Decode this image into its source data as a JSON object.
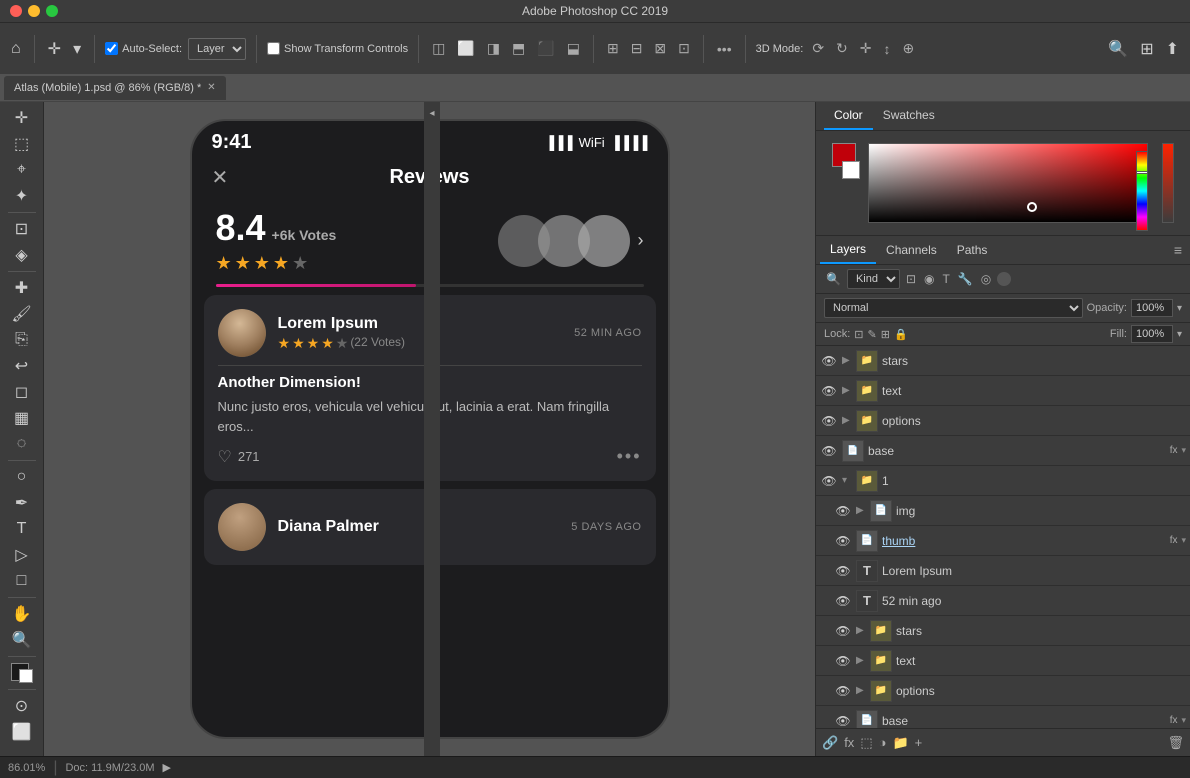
{
  "app": {
    "title": "Adobe Photoshop CC 2019",
    "tab": "Atlas (Mobile) 1.psd @ 86% (RGB/8) *"
  },
  "toolbar": {
    "auto_select_label": "Auto-Select:",
    "auto_select_value": "Layer",
    "transform_controls_label": "Show Transform Controls",
    "three_d_mode_label": "3D Mode:",
    "more_label": "..."
  },
  "color_panel": {
    "tab1": "Color",
    "tab2": "Swatches"
  },
  "layers_panel": {
    "tab1": "Layers",
    "tab2": "Channels",
    "tab3": "Paths",
    "filter_kind": "Kind",
    "blend_mode": "Normal",
    "opacity_label": "Opacity:",
    "opacity_value": "100%",
    "lock_label": "Lock:",
    "fill_label": "Fill:",
    "fill_value": "100%",
    "layers": [
      {
        "id": "stars1",
        "name": "stars",
        "type": "group",
        "visible": true,
        "indent": 0,
        "fx": false
      },
      {
        "id": "text1",
        "name": "text",
        "type": "group",
        "visible": true,
        "indent": 0,
        "fx": false
      },
      {
        "id": "options1",
        "name": "options",
        "type": "group",
        "visible": true,
        "indent": 0,
        "fx": false
      },
      {
        "id": "base1",
        "name": "base",
        "type": "smart",
        "visible": true,
        "indent": 0,
        "fx": true
      },
      {
        "id": "group1",
        "name": "1",
        "type": "group",
        "visible": true,
        "indent": 0,
        "fx": false,
        "expanded": true
      },
      {
        "id": "img1",
        "name": "img",
        "type": "smart",
        "visible": true,
        "indent": 1,
        "fx": false
      },
      {
        "id": "thumb1",
        "name": "thumb",
        "type": "smart",
        "visible": true,
        "indent": 1,
        "fx": true,
        "link": true
      },
      {
        "id": "loremipsum",
        "name": "Lorem Ipsum",
        "type": "text",
        "visible": true,
        "indent": 1,
        "fx": false
      },
      {
        "id": "52minago",
        "name": "52 min ago",
        "type": "text",
        "visible": true,
        "indent": 1,
        "fx": false
      },
      {
        "id": "stars2",
        "name": "stars",
        "type": "group",
        "visible": true,
        "indent": 1,
        "fx": false
      },
      {
        "id": "text2",
        "name": "text",
        "type": "group",
        "visible": true,
        "indent": 1,
        "fx": false
      },
      {
        "id": "options2",
        "name": "options",
        "type": "group",
        "visible": true,
        "indent": 1,
        "fx": false
      },
      {
        "id": "base2",
        "name": "base",
        "type": "smart",
        "visible": true,
        "indent": 1,
        "fx": true
      }
    ]
  },
  "phone": {
    "time": "9:41",
    "title": "Reviews",
    "score": "8.4",
    "votes": "+6k Votes",
    "reviewer1": {
      "name": "Lorem Ipsum",
      "time": "52 MIN AGO",
      "votes": "(22 Votes)",
      "title": "Another Dimension!",
      "body": "Nunc justo eros, vehicula vel vehicula ut, lacinia a erat. Nam fringilla eros...",
      "likes": "271"
    },
    "reviewer2": {
      "name": "Diana Palmer",
      "time": "5 DAYS AGO"
    }
  },
  "status_bar": {
    "zoom": "86.01%",
    "doc_info": "Doc: 11.9M/23.0M"
  }
}
